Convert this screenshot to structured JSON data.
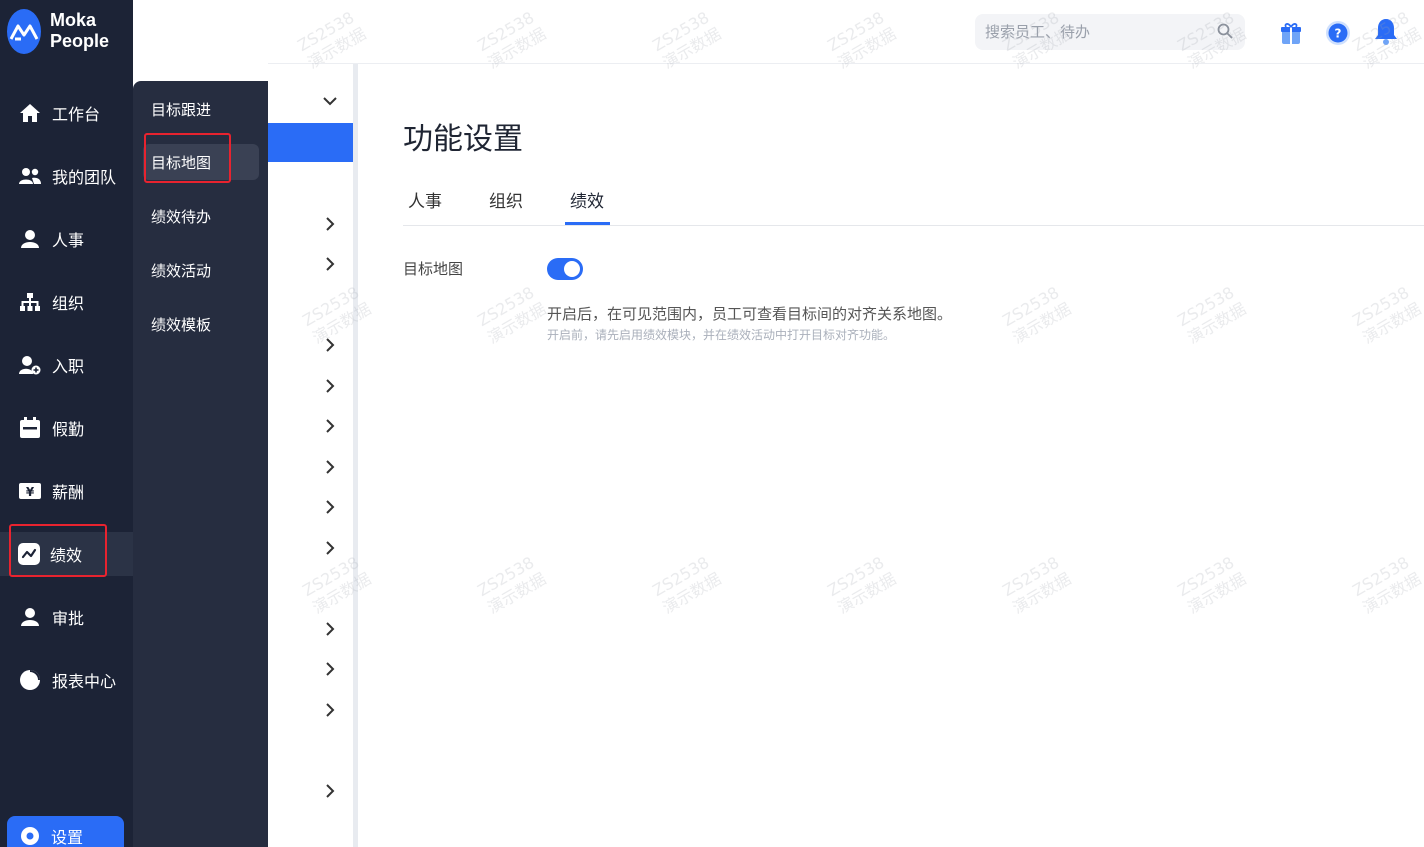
{
  "brand": {
    "name": "Moka People"
  },
  "sidebar": {
    "items": [
      {
        "label": "工作台",
        "icon": "home-icon"
      },
      {
        "label": "我的团队",
        "icon": "team-icon"
      },
      {
        "label": "人事",
        "icon": "person-icon"
      },
      {
        "label": "组织",
        "icon": "org-icon"
      },
      {
        "label": "入职",
        "icon": "onboard-icon"
      },
      {
        "label": "假勤",
        "icon": "calendar-icon"
      },
      {
        "label": "薪酬",
        "icon": "salary-icon"
      },
      {
        "label": "绩效",
        "icon": "performance-icon",
        "active": true
      },
      {
        "label": "审批",
        "icon": "approval-icon"
      },
      {
        "label": "报表中心",
        "icon": "report-icon"
      }
    ],
    "settings_label": "设置"
  },
  "subpanel": {
    "items": [
      {
        "label": "目标跟进"
      },
      {
        "label": "目标地图",
        "active": true
      },
      {
        "label": "绩效待办"
      },
      {
        "label": "绩效活动"
      },
      {
        "label": "绩效模板"
      }
    ]
  },
  "header": {
    "search_placeholder": "搜索员工、待办",
    "icons": [
      "gift-icon",
      "help-icon",
      "bell-icon"
    ],
    "help_glyph": "?"
  },
  "main": {
    "title": "功能设置",
    "tabs": [
      {
        "label": "人事"
      },
      {
        "label": "组织"
      },
      {
        "label": "绩效",
        "active": true
      }
    ],
    "setting": {
      "label": "目标地图",
      "enabled": true,
      "description": "开启后，在可见范围内，员工可查看目标间的对齐关系地图。",
      "hint": "开启前，请先启用绩效模块，并在绩效活动中打开目标对齐功能。"
    }
  },
  "colors": {
    "sidebar_bg": "#1c2336",
    "subpanel_bg": "#262d40",
    "accent": "#2a6cf6",
    "highlight_border": "#e8232f"
  },
  "watermark": {
    "code": "ZS2538",
    "text": "演示数据"
  }
}
